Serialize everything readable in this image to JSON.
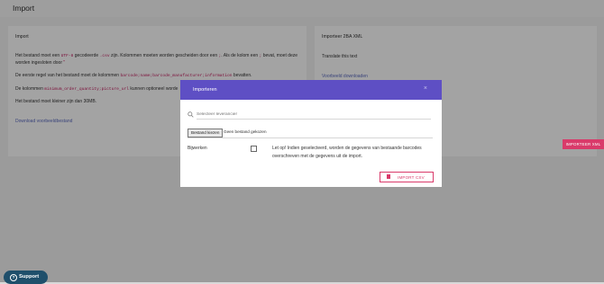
{
  "page": {
    "title": "Import"
  },
  "left_card": {
    "title": "Import",
    "p1_pre": "Het bestand moet een ",
    "p1_code1": "UTF-8",
    "p1_mid": " gecodeerde ",
    "p1_code2": ".csv",
    "p1_post": " zijn. Kolommen moeten worden gescheiden door een ",
    "p1_code3": ";",
    "p1_post2": ". Als de kolom een ",
    "p1_code4": ";",
    "p1_post3": " bevat, moet deze worden ingesloten door ",
    "p1_req": "\"",
    "p2_pre": "De eerste regel van het bestand moet de kolommen ",
    "p2_code": "barcode;name;barcode_manufacturer;information",
    "p2_post": " bevatten.",
    "p3_pre": "De kolommen ",
    "p3_code": "minimum_order_quantity;picture_url",
    "p3_post": " kunnen optioneel worde",
    "p4": "Het bestand moet kleiner zijn dan 30MB.",
    "download": "Download voorbeeldbestand"
  },
  "right_card": {
    "title": "Importeer 2BA XML",
    "text": "Translate this text",
    "link": "Voorbeeld downloaden"
  },
  "floating_button": "IMPORTEER XML",
  "support": {
    "label": "Support",
    "icon": "question-icon"
  },
  "modal": {
    "title": "Importeren",
    "close": "×",
    "search_placeholder": "Selecteer leverancier",
    "file_button": "Bestand kiezen",
    "file_status": "Geen bestand gekozen",
    "update_label": "Bijwerken",
    "warning": "Let op! Indien geselecteerd, worden de gegevens van bestaande barcodes overschreven met de gegevens uit de import.",
    "import_button": "IMPORT CSV"
  },
  "colors": {
    "accent": "#d93a6a",
    "header": "#5e4fc4",
    "support": "#1f4f6b",
    "link": "#5c6bc0"
  }
}
